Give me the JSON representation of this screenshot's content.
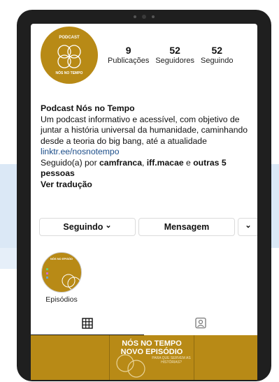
{
  "profile": {
    "avatar_top_text": "PODCAST",
    "avatar_bottom_text": "NÓS NO TEMPO",
    "stats": [
      {
        "value": "9",
        "label": "Publicações"
      },
      {
        "value": "52",
        "label": "Seguidores"
      },
      {
        "value": "52",
        "label": "Seguindo"
      }
    ],
    "name": "Podcast Nós no Tempo",
    "bio": "Um podcast informativo e acessível, com objetivo de juntar a história universal da humanidade, caminhando desde a teoria do big bang, até a atualidade",
    "link": "linktr.ee/nosnotempo",
    "followed_prefix": "Seguido(a) por ",
    "followed_user1": "camfranca",
    "followed_sep": ", ",
    "followed_user2": "iff.macae",
    "followed_and": " e ",
    "followed_others": "outras 5 pessoas",
    "translate": "Ver tradução"
  },
  "buttons": {
    "following": "Seguindo",
    "following_chevron": "⌄",
    "message": "Mensagem",
    "more": "⌄"
  },
  "highlights": [
    {
      "label": "Episódios",
      "cover_title": "NÓS NO EPISÓD"
    }
  ],
  "tabs": [
    {
      "icon": "grid-icon"
    },
    {
      "icon": "tagged-icon"
    }
  ],
  "post": {
    "title_line1": "NÓS NO TEMPO",
    "title_line2": "NOVO EPISÓDIO",
    "subtitle": "PARA QUE SERVEM AS HISTÓRIAS?"
  },
  "colors": {
    "brand_gold": "#b88a16",
    "link_blue": "#1b4d89"
  }
}
